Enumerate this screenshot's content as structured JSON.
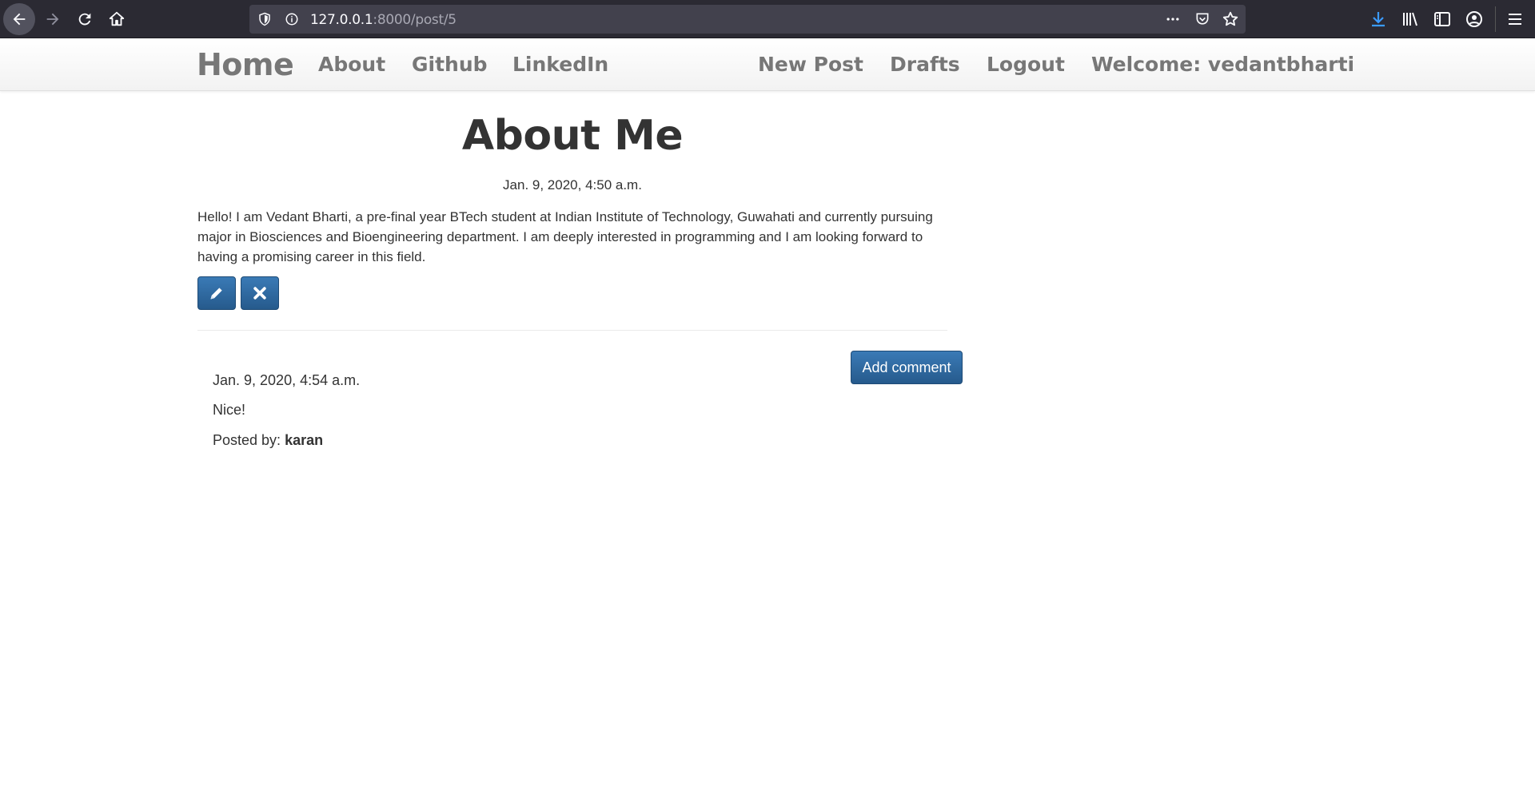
{
  "browser": {
    "url_host": "127.0.0.1",
    "url_path": ":8000/post/5",
    "icons": [
      "back-icon",
      "forward-icon",
      "reload-icon",
      "home-icon",
      "shield-icon",
      "info-icon",
      "more-icon",
      "pocket-icon",
      "star-icon",
      "download-icon",
      "library-icon",
      "sidebar-icon",
      "account-icon",
      "menu-icon"
    ]
  },
  "nav": {
    "brand": "Home",
    "about": "About",
    "github": "Github",
    "linkedin": "LinkedIn",
    "new_post": "New Post",
    "drafts": "Drafts",
    "logout": "Logout",
    "welcome": "Welcome: vedantbharti"
  },
  "post": {
    "title": "About Me",
    "date": "Jan. 9, 2020, 4:50 a.m.",
    "body": "Hello! I am Vedant Bharti, a pre-final year BTech student at Indian Institute of Technology, Guwahati and currently pursuing major in Biosciences and Bioengineering department. I am deeply interested in programming and I am looking forward to having a promising career in this field."
  },
  "actions": {
    "edit_icon": "pencil-icon",
    "delete_icon": "close-icon",
    "add_comment": "Add comment"
  },
  "comments": [
    {
      "date": "Jan. 9, 2020, 4:54 a.m.",
      "text": "Nice!",
      "posted_by_label": "Posted by:",
      "author": "karan"
    }
  ],
  "colors": {
    "button": "#2f6ba3",
    "nav_text": "#777777",
    "browser_bg": "#2b2a33"
  }
}
